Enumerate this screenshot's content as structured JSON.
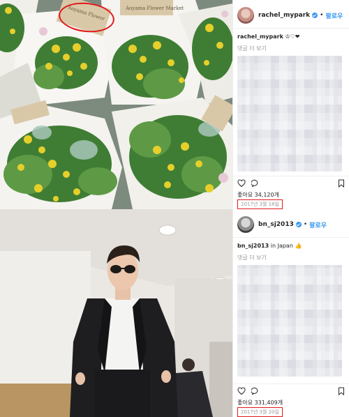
{
  "post1": {
    "photo_sign_text": "Aoyama Flower Market",
    "photo_sign_circled": "Aoyama Flower",
    "username": "rachel_mypark",
    "follow_label": "팔로우",
    "caption_user": "rachel_mypark",
    "caption_emoji": "♔♡❤",
    "more_comments": "댓글 더 보기",
    "likes": "좋아요 34,120개",
    "date": "2017년 3월 18일",
    "highlight_color": "#e0191b"
  },
  "post2": {
    "username": "bn_sj2013",
    "follow_label": "팔로우",
    "caption_user": "bn_sj2013",
    "caption_text": "in Japan",
    "caption_emoji": "👍",
    "more_comments": "댓글 더 보기",
    "likes": "좋아요 331,409개",
    "date": "2017년 3월 20일",
    "highlight_color": "#e0191b"
  },
  "icons": [
    "heart-icon",
    "comment-icon",
    "bookmark-icon",
    "verified-badge-icon"
  ],
  "colors": {
    "link": "#3897f0",
    "text": "#262626",
    "muted": "#999999",
    "highlight": "#e0191b"
  }
}
